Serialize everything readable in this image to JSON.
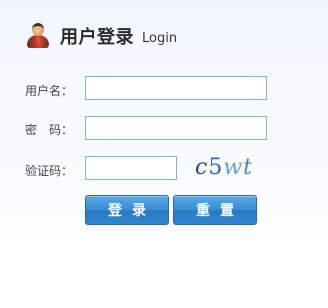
{
  "header": {
    "title_cn": "用户登录",
    "title_en": "Login",
    "icon": "user-icon"
  },
  "form": {
    "username_label": "用户名：",
    "username_value": "",
    "password_label": "密　码：",
    "password_value": "",
    "captcha_label": "验证码：",
    "captcha_value": "",
    "captcha_image": {
      "c": "c",
      "d5": "5",
      "w": "w",
      "t": "t"
    }
  },
  "buttons": {
    "login": "登录",
    "reset": "重置"
  },
  "colors": {
    "input_border": "#7fb4d6",
    "button_blue": "#3b8fd6"
  }
}
